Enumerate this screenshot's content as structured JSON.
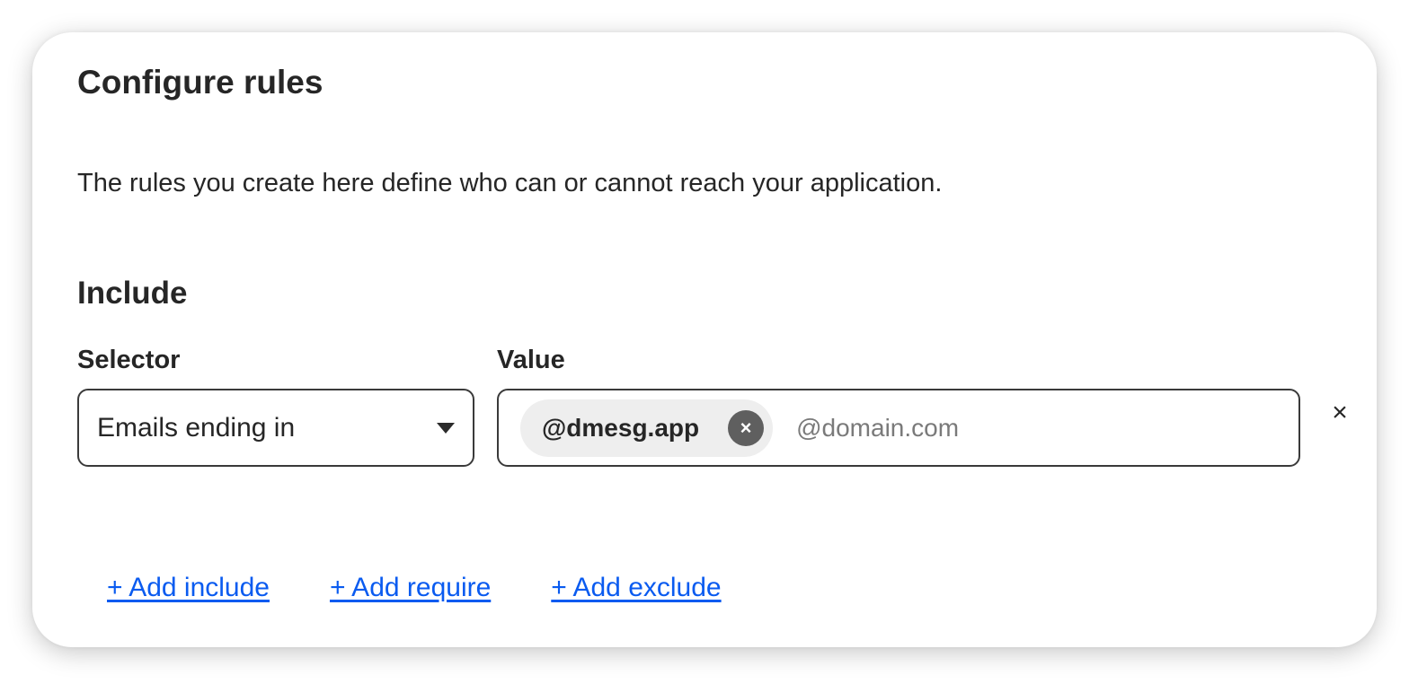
{
  "title": "Configure rules",
  "description": "The rules you create here define who can or cannot reach your application.",
  "include_section": {
    "heading": "Include",
    "selector": {
      "label": "Selector",
      "selected_value": "Emails ending in"
    },
    "value": {
      "label": "Value",
      "chips": [
        {
          "text": "@dmesg.app",
          "remove_icon": "×"
        }
      ],
      "input_value": "",
      "placeholder": "@domain.com"
    },
    "row_remove_icon": "×"
  },
  "actions": {
    "add_include": "+ Add include",
    "add_require": "+ Add require",
    "add_exclude": "+ Add exclude"
  },
  "colors": {
    "link": "#0a5bf0",
    "text": "#262626",
    "chip_background": "#eeeeee",
    "chip_remove_background": "#5f5f5f"
  }
}
